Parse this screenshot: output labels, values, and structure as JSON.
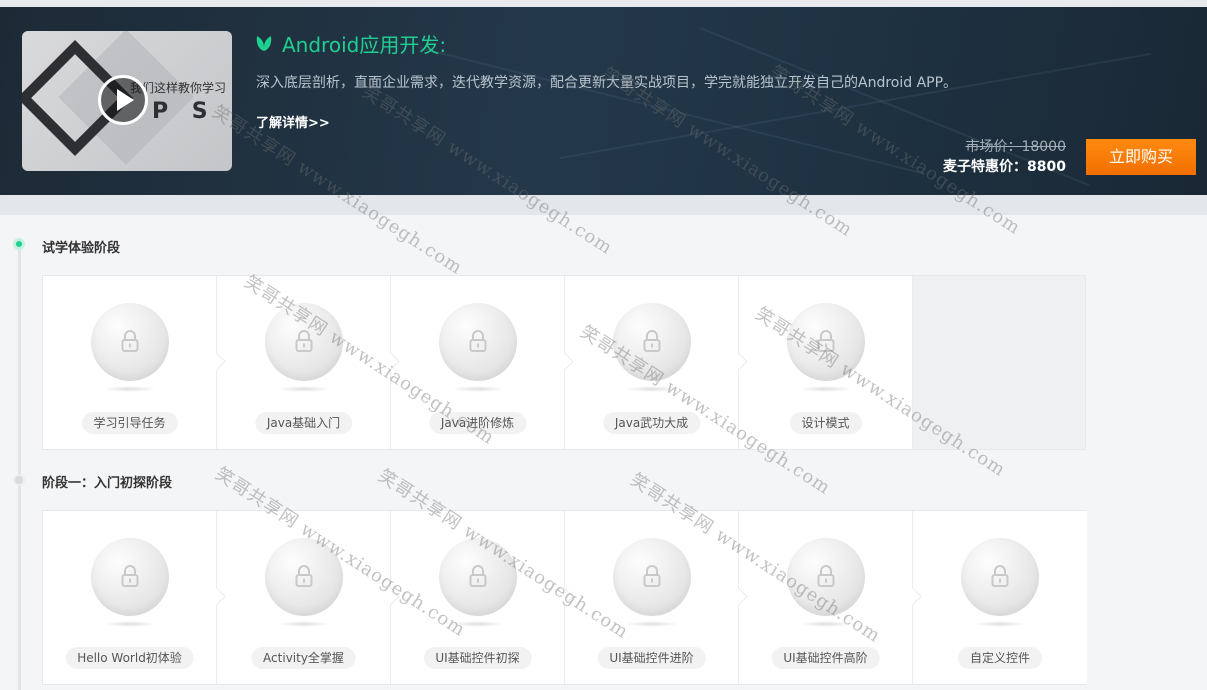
{
  "banner": {
    "thumbnail": {
      "caption": "我们这样教你学习",
      "letters": "P S",
      "play_icon": "play-icon"
    },
    "course_icon": "leaf-icon",
    "title": "Android应用开发:",
    "description": "深入底层剖析，直面企业需求，迭代教学资源，配合更新大量实战项目，学完就能独立开发自己的Android APP。",
    "detail_link": "了解详情>>",
    "market_price": "市场价：18000",
    "special_price": "麦子特惠价：8800",
    "buy_button": "立即购买",
    "colors": {
      "title": "#1fcf8f",
      "buy_button": "#f57a00",
      "banner_bg": "#1e2f3d"
    }
  },
  "stages": [
    {
      "title": "试学体验阶段",
      "active": true,
      "cards": [
        {
          "label": "学习引导任务",
          "icon": "lock-icon"
        },
        {
          "label": "Java基础入门",
          "icon": "lock-icon"
        },
        {
          "label": "Java进阶修炼",
          "icon": "lock-icon"
        },
        {
          "label": "Java武功大成",
          "icon": "lock-icon"
        },
        {
          "label": "设计模式",
          "icon": "lock-icon"
        }
      ]
    },
    {
      "title": "阶段一：入门初探阶段",
      "active": false,
      "cards": [
        {
          "label": "Hello World初体验",
          "icon": "lock-icon"
        },
        {
          "label": "Activity全掌握",
          "icon": "lock-icon"
        },
        {
          "label": "UI基础控件初探",
          "icon": "lock-icon"
        },
        {
          "label": "UI基础控件进阶",
          "icon": "lock-icon"
        },
        {
          "label": "UI基础控件高阶",
          "icon": "lock-icon"
        },
        {
          "label": "自定义控件",
          "icon": "lock-icon"
        }
      ]
    }
  ],
  "watermark": {
    "text": "笑哥共享网 www.xiaogegh.com"
  }
}
